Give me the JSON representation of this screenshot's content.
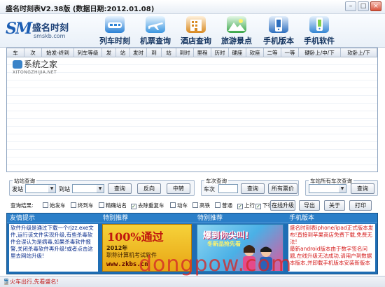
{
  "window": {
    "title": "盛名时刻表V2.38版 (数据日期:2012.01.08)",
    "minimize_label": "–",
    "maximize_label": "□",
    "close_label": "×"
  },
  "logo": {
    "mark": "SM",
    "name": "盛名时刻",
    "site": "smskb.com"
  },
  "toolbar": {
    "items": [
      {
        "label": "列车时刻",
        "icon": "train-icon",
        "color": "#2b82d6"
      },
      {
        "label": "机票查询",
        "icon": "airplane-icon",
        "color": "#3b96e0"
      },
      {
        "label": "酒店查询",
        "icon": "hotel-icon",
        "color": "#d88a22"
      },
      {
        "label": "旅游景点",
        "icon": "landscape-icon",
        "color": "#3aa64a"
      },
      {
        "label": "手机版本",
        "icon": "mobile-phone-icon",
        "color": "#2d6fbf"
      },
      {
        "label": "手机软件",
        "icon": "mobile-app-icon",
        "color": "#3587d4"
      }
    ]
  },
  "grid": {
    "columns": [
      "车",
      "次",
      "始发-终到",
      "列车等级",
      "发",
      "站",
      "发时",
      "到",
      "站",
      "到时",
      "里程",
      "历时",
      "硬座",
      "软座",
      "二等",
      "一等",
      "硬卧上/中/下",
      "软卧上/下"
    ]
  },
  "watermark": {
    "name": "系统之家",
    "url": "XITONGZHIJIA.NET"
  },
  "station_query": {
    "legend": "站站查询",
    "from_label": "发站",
    "to_label": "到站",
    "query_button": "查询",
    "reverse_button": "反向",
    "transfer_button": "中转"
  },
  "train_query": {
    "legend": "车次查询",
    "train_label": "车次",
    "query_button": "查询",
    "all_fares_button": "所有票价"
  },
  "station_all_query": {
    "legend": "车站所有车次查询",
    "query_button": "查询"
  },
  "filters": {
    "result_label": "查询结果:",
    "options": [
      {
        "label": "始发车",
        "checked": false
      },
      {
        "label": "终到车",
        "checked": false
      },
      {
        "label": "精确站名",
        "checked": false
      },
      {
        "label": "去除重复车",
        "checked": true
      },
      {
        "label": "动车",
        "checked": false
      },
      {
        "label": "高铁",
        "checked": false
      },
      {
        "label": "普通",
        "checked": false
      },
      {
        "label": "上行",
        "checked": true
      },
      {
        "label": "下行",
        "checked": true
      }
    ],
    "online_upgrade_button": "在线升级",
    "export_button": "导出",
    "about_button": "关于",
    "print_button": "打印"
  },
  "bottom": {
    "friendly_tip": {
      "header": "友情提示",
      "text": "软件升级是通过下载一个rjzz.exe文件,运行该文件实现升级,有些杀毒软件会误认为是病毒,如果杀毒软件报警,关闭杀毒软件再升级!或者点击这里去网站升级!"
    },
    "recommend1": {
      "header": "特别推荐",
      "big": "100%通过",
      "year": "2012年",
      "sub": "职称计算机考试软件",
      "url": "www.zkbs.cn"
    },
    "recommend2": {
      "header": "特别推荐",
      "t1": "爆到你尖叫!",
      "t2": "冬新品抢先看"
    },
    "mobile": {
      "header": "手机版本",
      "text1": "盛名时刻表iphone/ipad正式版本发布!直接到苹果商店免费下载,免费无法!",
      "text2": "最新android版本由于数字签名问题,在线升级无法成功,请用户到数据本版本,并卸载手机版本安装新版本"
    }
  },
  "status": {
    "text": "火车出行,先看盛名!"
  },
  "site_watermark": "dongpow.com"
}
